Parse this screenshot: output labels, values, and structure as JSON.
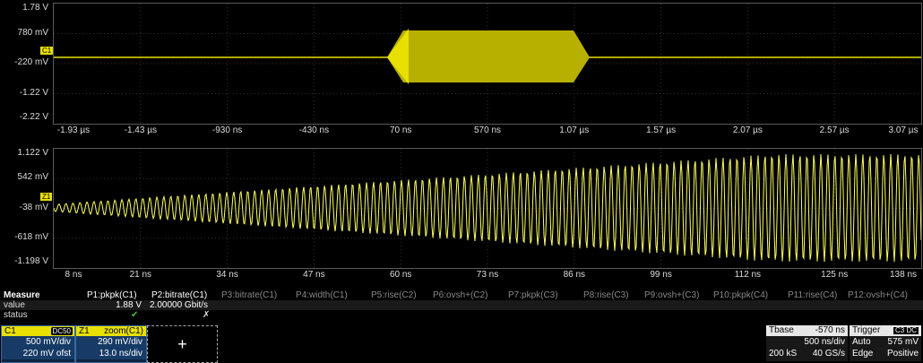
{
  "upper_grid": {
    "y_labels": [
      "1.78 V",
      "780 mV",
      "-220 mV",
      "-1.22 V",
      "-2.22 V"
    ],
    "x_labels": [
      "-1.93 µs",
      "-1.43 µs",
      "-930 ns",
      "-430 ns",
      "70 ns",
      "570 ns",
      "1.07 µs",
      "1.57 µs",
      "2.07 µs",
      "2.57 µs",
      "3.07 µs"
    ],
    "marker": "C1",
    "trace_color": "#e8e000"
  },
  "lower_grid": {
    "y_labels": [
      "1.122 V",
      "542 mV",
      "-38 mV",
      "-618 mV",
      "-1.198 V"
    ],
    "x_labels": [
      "8 ns",
      "21 ns",
      "34 ns",
      "47 ns",
      "60 ns",
      "73 ns",
      "86 ns",
      "99 ns",
      "112 ns",
      "125 ns",
      "138 ns"
    ],
    "marker": "Z1",
    "trace_color": "#ffff60"
  },
  "measure": {
    "title": "Measure",
    "row_labels": [
      "value",
      "status"
    ],
    "params": [
      "P1:pkpk(C1)",
      "P2:bitrate(C1)",
      "P3:bitrate(C1)",
      "P4:width(C1)",
      "P5:rise(C2)",
      "P6:ovsh+(C2)",
      "P7:pkpk(C3)",
      "P8:rise(C3)",
      "P9:ovsh+(C3)",
      "P10:pkpk(C4)",
      "P11:rise(C4)",
      "P12:ovsh+(C4)"
    ],
    "values": [
      "1.88 V",
      "2.00000 Gbit/s"
    ],
    "status": [
      "✔",
      "✗"
    ]
  },
  "c1": {
    "name": "C1",
    "coupling": "DC50",
    "vdiv": "500 mV/div",
    "offset": "220 mV ofst"
  },
  "z1": {
    "name": "Z1",
    "source": "zoom(C1)",
    "vdiv": "290 mV/div",
    "tdiv": "13.0 ns/div"
  },
  "add_label": "+",
  "tbase": {
    "title": "Tbase",
    "delay": "-570 ns",
    "tdiv": "500 ns/div",
    "samples": "200 kS",
    "rate": "40 GS/s"
  },
  "trigger": {
    "title": "Trigger",
    "src": "C3",
    "coup": "DC",
    "mode": "Auto",
    "level": "575 mV",
    "type": "Edge",
    "slope": "Positive"
  }
}
